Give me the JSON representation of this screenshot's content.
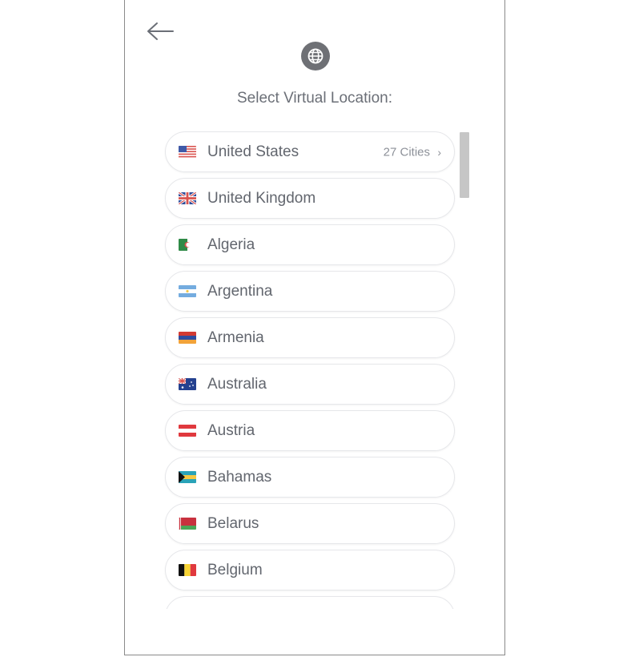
{
  "header": {
    "back_icon": "arrow-left-icon",
    "globe_icon": "globe-icon",
    "title": "Select Virtual Location:"
  },
  "locations": [
    {
      "name": "United States",
      "flag": "us",
      "cities": "27 Cities",
      "chevron": "›"
    },
    {
      "name": "United Kingdom",
      "flag": "gb"
    },
    {
      "name": "Algeria",
      "flag": "dz"
    },
    {
      "name": "Argentina",
      "flag": "ar"
    },
    {
      "name": "Armenia",
      "flag": "am"
    },
    {
      "name": "Australia",
      "flag": "au"
    },
    {
      "name": "Austria",
      "flag": "at"
    },
    {
      "name": "Bahamas",
      "flag": "bs"
    },
    {
      "name": "Belarus",
      "flag": "by"
    },
    {
      "name": "Belgium",
      "flag": "be"
    },
    {
      "name": "",
      "flag": "partial"
    }
  ],
  "colors": {
    "text": "#62666e",
    "accent_gray": "#6e7075",
    "row_border": "#e6e7ea",
    "scrollbar": "#c6c6c6"
  }
}
